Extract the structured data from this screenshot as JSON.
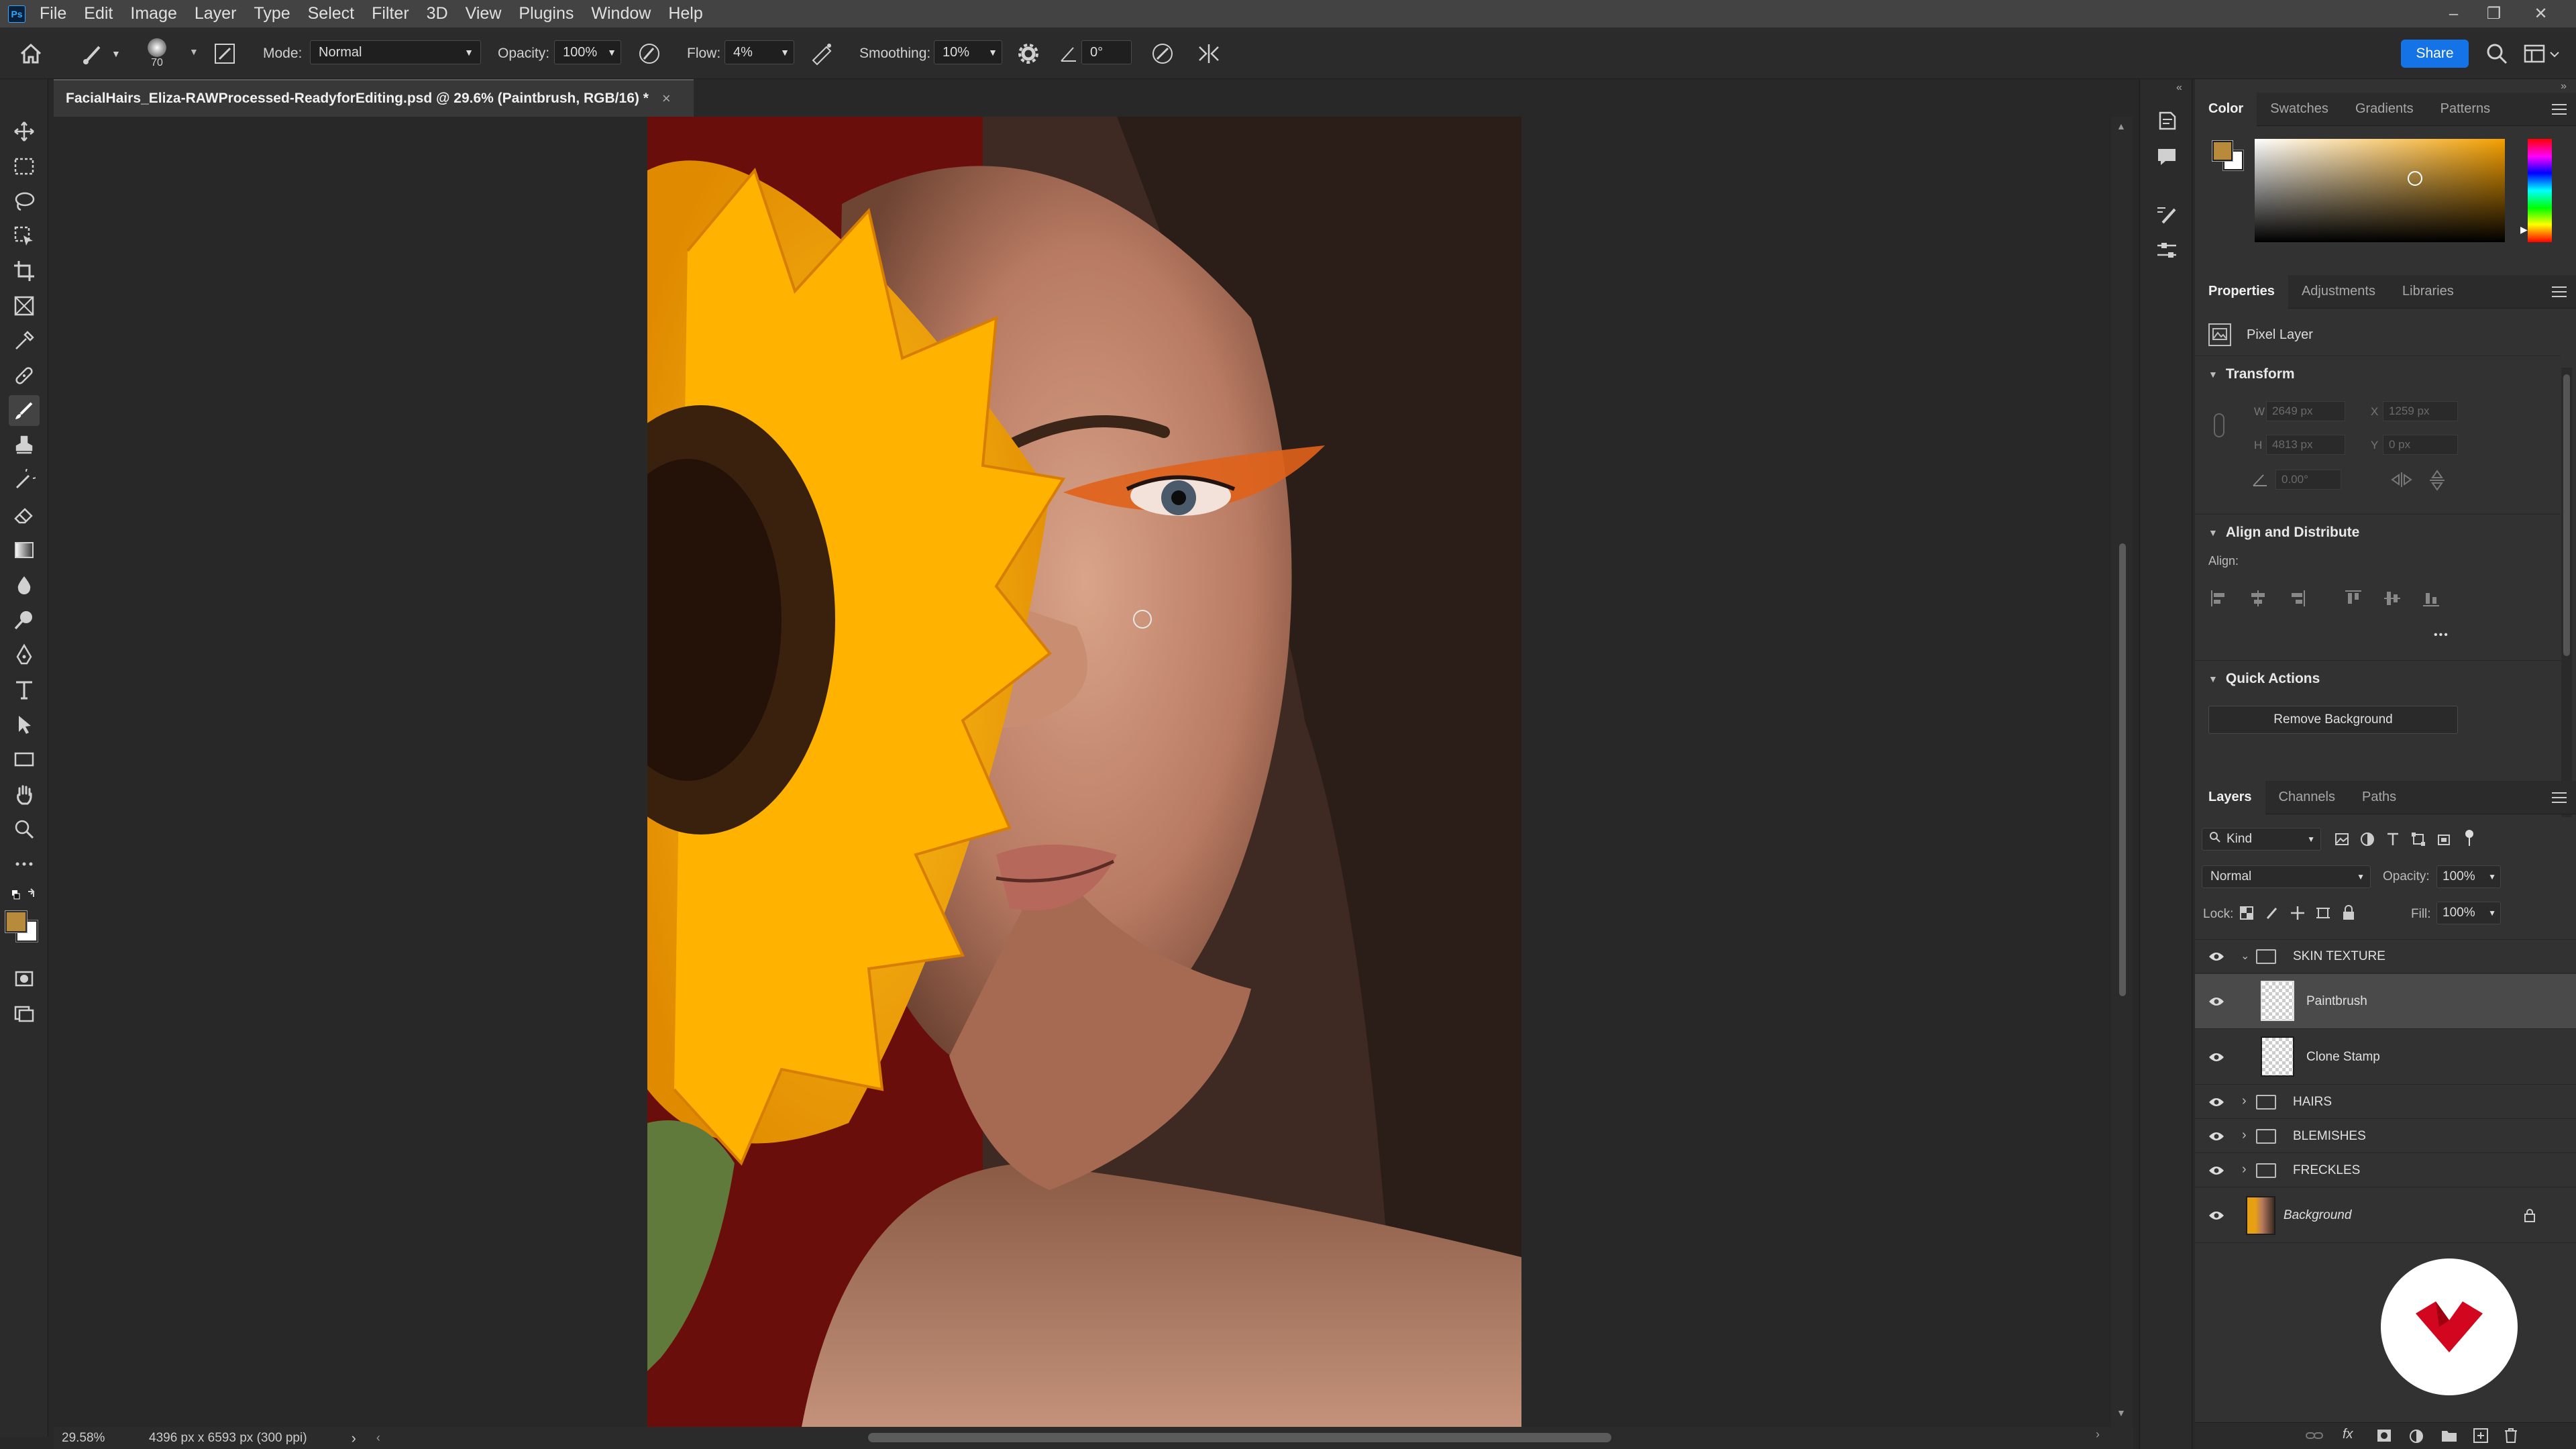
{
  "app": {
    "logo": "Ps"
  },
  "menu": [
    "File",
    "Edit",
    "Image",
    "Layer",
    "Type",
    "Select",
    "Filter",
    "3D",
    "View",
    "Plugins",
    "Window",
    "Help"
  ],
  "options": {
    "brush_size": "70",
    "mode_label": "Mode:",
    "mode_value": "Normal",
    "opacity_label": "Opacity:",
    "opacity_value": "100%",
    "flow_label": "Flow:",
    "flow_value": "4%",
    "smoothing_label": "Smoothing:",
    "smoothing_value": "10%",
    "angle_value": "0°",
    "share_label": "Share"
  },
  "document": {
    "tab_title": "FacialHairs_Eliza-RAWProcessed-ReadyforEditing.psd @ 29.6% (Paintbrush, RGB/16) *",
    "close": "×"
  },
  "status": {
    "zoom": "29.58%",
    "info": "4396 px x 6593 px (300 ppi)",
    "arrow": "›"
  },
  "color_panel": {
    "tabs": [
      "Color",
      "Swatches",
      "Gradients",
      "Patterns"
    ],
    "foreground": "#b78a3c",
    "background": "#ffffff",
    "hue": "#f5a000"
  },
  "properties": {
    "tabs": [
      "Properties",
      "Adjustments",
      "Libraries"
    ],
    "layer_kind": "Pixel Layer",
    "transform": {
      "title": "Transform",
      "w_label": "W",
      "w": "2649 px",
      "x_label": "X",
      "x": "1259 px",
      "h_label": "H",
      "h": "4813 px",
      "y_label": "Y",
      "y": "0 px",
      "angle": "0.00°"
    },
    "align": {
      "title": "Align and Distribute",
      "label": "Align:",
      "more": "•••"
    },
    "quick_actions": {
      "title": "Quick Actions",
      "button": "Remove Background"
    }
  },
  "layers_panel": {
    "tabs": [
      "Layers",
      "Channels",
      "Paths"
    ],
    "filter_kind": "Kind",
    "blend_mode": "Normal",
    "opacity_label": "Opacity:",
    "opacity": "100%",
    "lock_label": "Lock:",
    "fill_label": "Fill:",
    "fill": "100%",
    "layers": [
      {
        "name": "SKIN TEXTURE",
        "type": "group",
        "expanded": true
      },
      {
        "name": "Paintbrush",
        "type": "pixel",
        "selected": true,
        "indent": true
      },
      {
        "name": "Clone Stamp",
        "type": "pixel",
        "indent": true
      },
      {
        "name": "HAIRS",
        "type": "group"
      },
      {
        "name": "BLEMISHES",
        "type": "group"
      },
      {
        "name": "FRECKLES",
        "type": "group"
      },
      {
        "name": "Background",
        "type": "background",
        "locked": true
      }
    ]
  }
}
